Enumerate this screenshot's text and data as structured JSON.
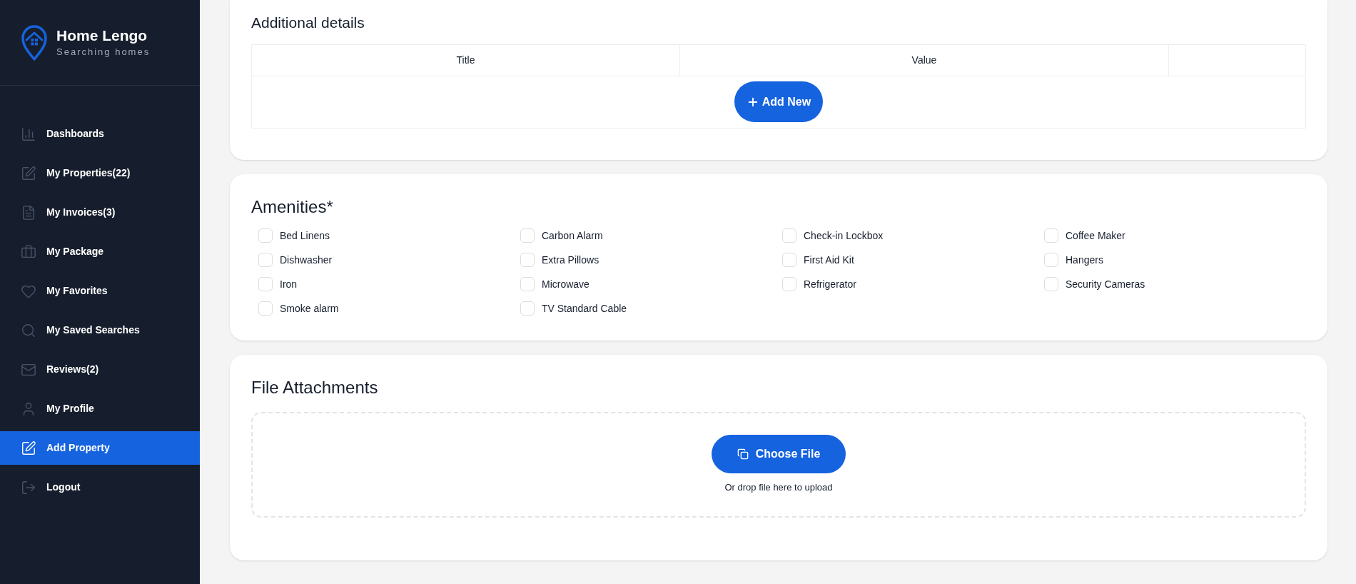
{
  "brand": {
    "name": "Home Lengo",
    "tagline": "Searching homes"
  },
  "sidebar": {
    "items": [
      {
        "kind": "dashboard",
        "label": "Dashboards",
        "selected": false
      },
      {
        "kind": "properties",
        "label": "My Properties(22)",
        "selected": false
      },
      {
        "kind": "invoices",
        "label": "My Invoices(3)",
        "selected": false
      },
      {
        "kind": "package",
        "label": "My Package",
        "selected": false
      },
      {
        "kind": "favorites",
        "label": "My Favorites",
        "selected": false
      },
      {
        "kind": "searches",
        "label": "My Saved Searches",
        "selected": false
      },
      {
        "kind": "reviews",
        "label": "Reviews(2)",
        "selected": false
      },
      {
        "kind": "profile",
        "label": "My Profile",
        "selected": false
      },
      {
        "kind": "add",
        "label": "Add Property",
        "selected": true
      },
      {
        "kind": "logout",
        "label": "Logout",
        "selected": false
      }
    ]
  },
  "additional_details": {
    "title": "Additional details",
    "columns": [
      "Title",
      "Value"
    ],
    "add_button": "Add New"
  },
  "amenities": {
    "title": "Amenities*",
    "items": [
      {
        "label": "Bed Linens",
        "checked": false
      },
      {
        "label": "Carbon Alarm",
        "checked": false
      },
      {
        "label": "Check-in Lockbox",
        "checked": false
      },
      {
        "label": "Coffee Maker",
        "checked": false
      },
      {
        "label": "Dishwasher",
        "checked": false
      },
      {
        "label": "Extra Pillows",
        "checked": false
      },
      {
        "label": "First Aid Kit",
        "checked": false
      },
      {
        "label": "Hangers",
        "checked": false
      },
      {
        "label": "Iron",
        "checked": false
      },
      {
        "label": "Microwave",
        "checked": false
      },
      {
        "label": "Refrigerator",
        "checked": false
      },
      {
        "label": "Security Cameras",
        "checked": false
      },
      {
        "label": "Smoke alarm",
        "checked": false
      },
      {
        "label": "TV Standard Cable",
        "checked": false
      }
    ]
  },
  "file_attachments": {
    "title": "File Attachments",
    "button": "Choose File",
    "hint": "Or drop file here to upload"
  }
}
